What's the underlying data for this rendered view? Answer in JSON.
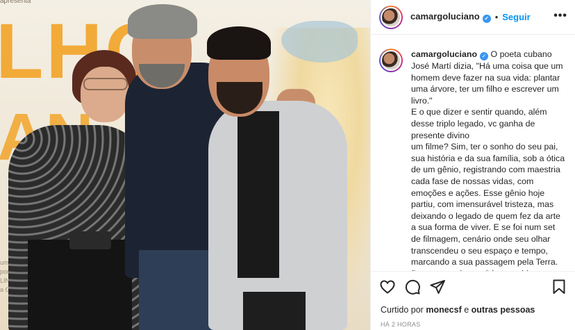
{
  "photo": {
    "banner_top": "apresenta",
    "poster_letters": "LHO",
    "poster_letters_2": "AN",
    "poster_credits": [
      "uma DOIS FI",
      "por BREN",
      "LINA KOTSO",
      "a GLOBO F"
    ]
  },
  "header": {
    "username": "camargoluciano",
    "verified": "✓",
    "separator": "•",
    "follow_label": "Seguir",
    "more": "•••"
  },
  "caption": {
    "username": "camargoluciano",
    "text": "O poeta cubano José Martí dizia, \"Há uma coisa que um homem deve fazer na sua vida: plantar uma árvore, ter um filho e escrever um livro.\"\nE o que dizer e sentir quando, além desse triplo legado, vc ganha de presente divino\num filme? Sim, ter o sonho do seu pai, sua história e da sua família, sob a ótica de um gênio, registrando com maestria cada fase de nossas vidas, com emoções e ações. Esse gênio hoje partiu, com imensurável tristeza, mas deixando o legado de quem fez da arte a sua forma de viver. E se foi num set de filmagem, cenário onde seu olhar transcendeu o seu espaço e tempo, marcando a sua passagem pela Terra. Deus te receba no Céu, querido BRENO!"
  },
  "actions": {
    "liked_by_prefix": "Curtido por",
    "liked_by_user": "monecsf",
    "liked_by_and": "e",
    "liked_by_others": "outras pessoas",
    "timestamp": "HÁ 2 HORAS"
  },
  "icons": [
    "heart-icon",
    "comment-icon",
    "share-icon",
    "bookmark-icon"
  ]
}
